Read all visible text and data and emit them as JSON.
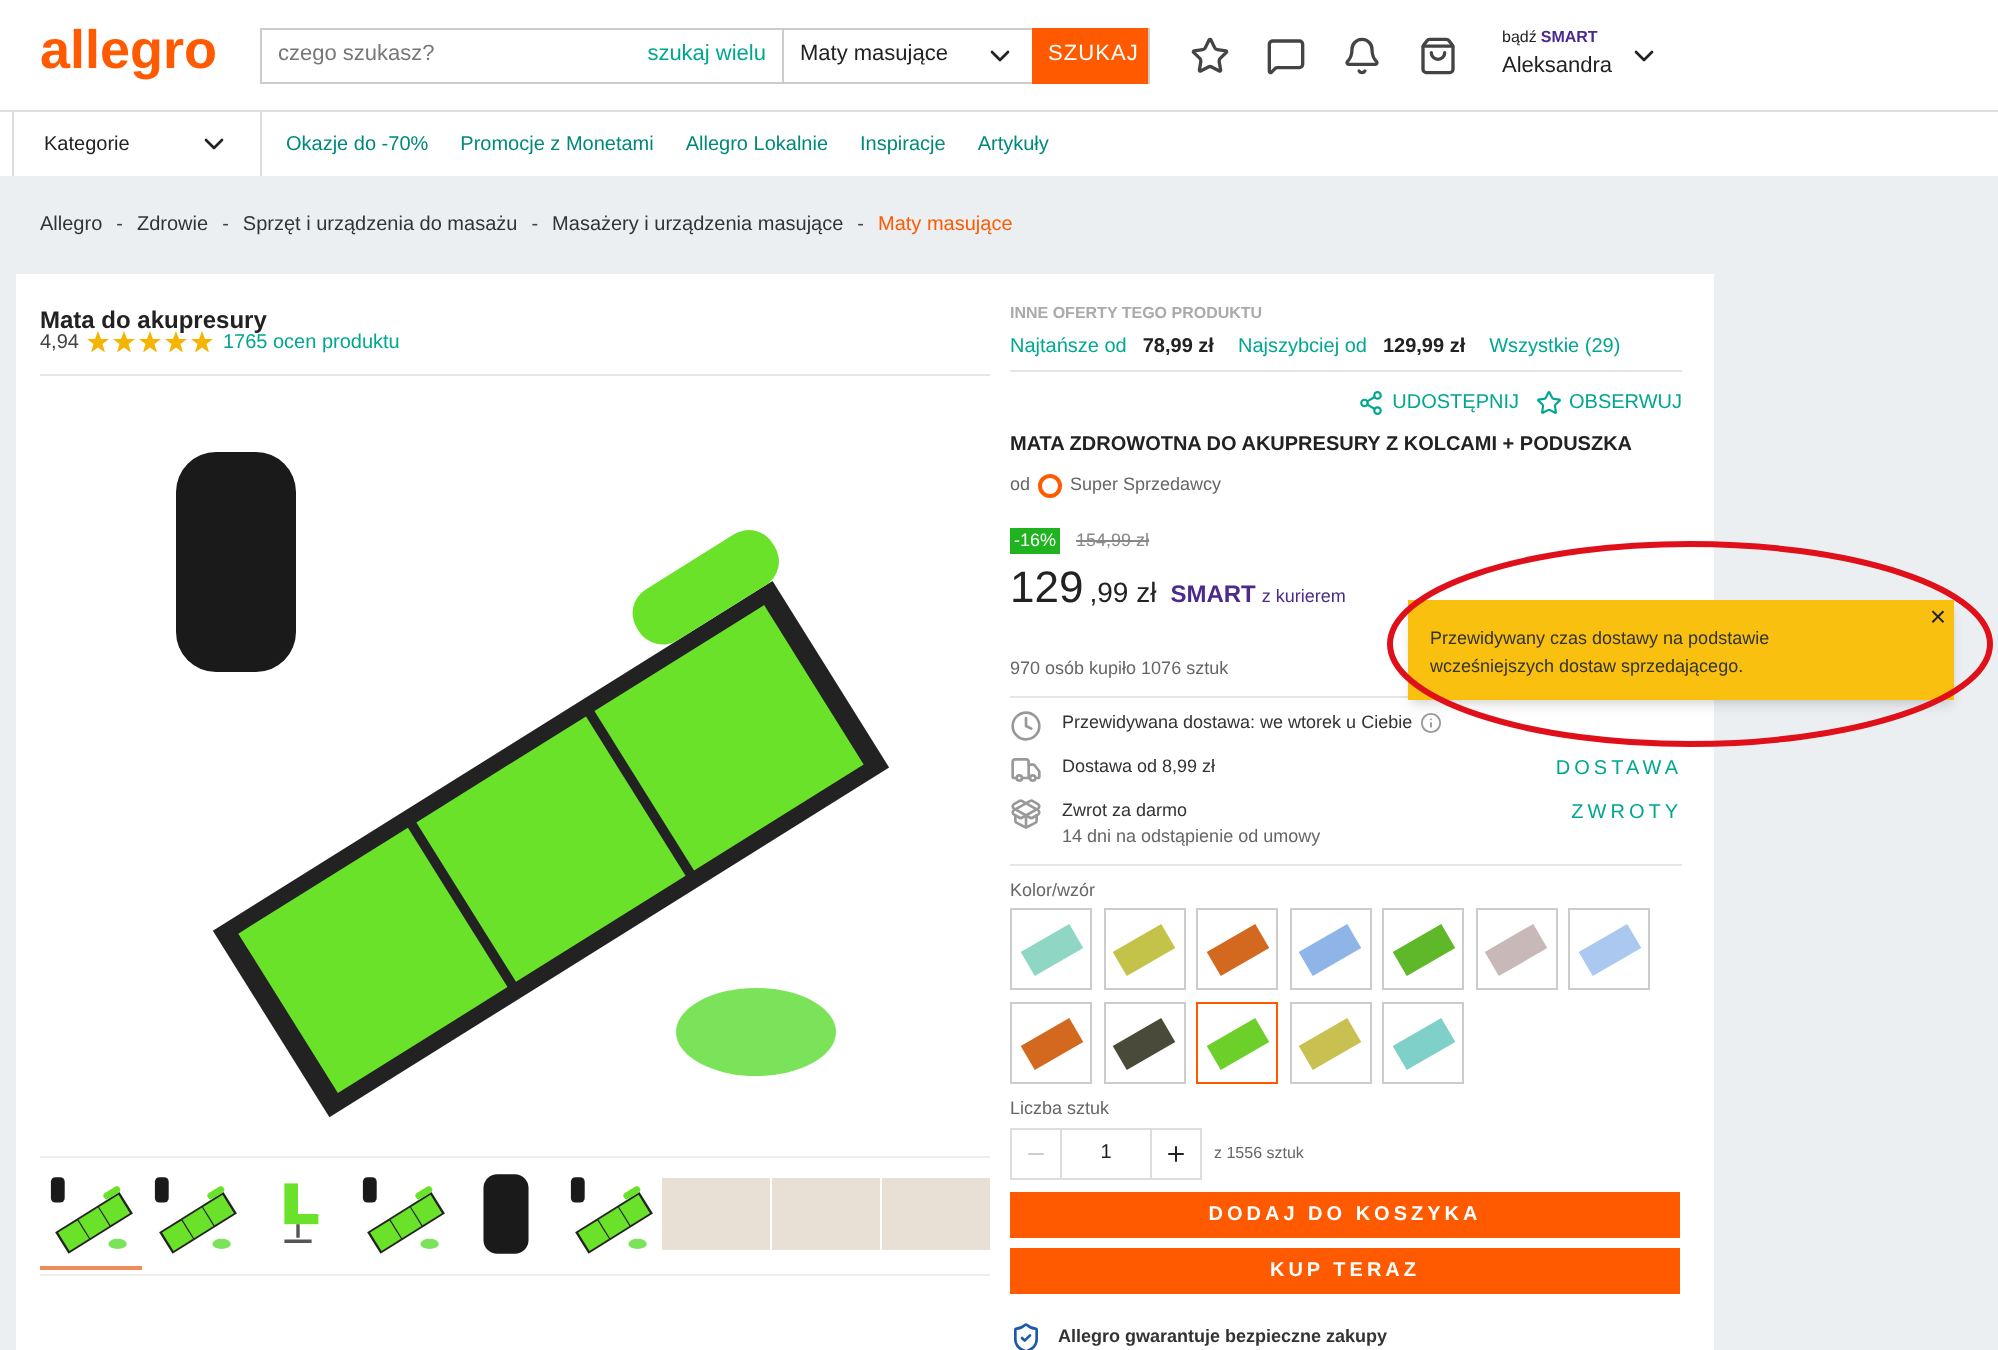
{
  "header": {
    "logo": "allegro",
    "search": {
      "placeholder": "czego szukasz?",
      "many_link": "szukaj wielu",
      "category": "Maty masujące",
      "button": "SZUKAJ"
    },
    "smart_prefix": "bądź",
    "smart": "SMART",
    "user": "Aleksandra"
  },
  "nav": {
    "categories": "Kategorie",
    "links": [
      "Okazje do -70%",
      "Promocje z Monetami",
      "Allegro Lokalnie",
      "Inspiracje",
      "Artykuły"
    ]
  },
  "breadcrumb": [
    {
      "label": "Allegro",
      "current": false
    },
    {
      "sep": "-",
      "label": "Zdrowie",
      "current": false
    },
    {
      "sep": "-",
      "label": "Sprzęt i urządzenia do masażu",
      "current": false
    },
    {
      "sep": "-",
      "label": "Masażery i urządzenia masujące",
      "current": false
    },
    {
      "sep": "-",
      "label": "Maty masujące",
      "current": true
    }
  ],
  "product": {
    "name": "Mata do akupresury",
    "rating": "4,94",
    "stars": 5,
    "reviews": "1765 ocen produktu",
    "thumbnails": [
      {
        "kind": "mat",
        "selected": true
      },
      {
        "kind": "mat",
        "selected": false
      },
      {
        "kind": "chair",
        "selected": false
      },
      {
        "kind": "mat",
        "selected": false
      },
      {
        "kind": "bag",
        "selected": false
      },
      {
        "kind": "mat",
        "selected": false
      },
      {
        "kind": "photo",
        "selected": false
      },
      {
        "kind": "photo",
        "selected": false
      },
      {
        "kind": "photo",
        "selected": false
      }
    ]
  },
  "offers": {
    "heading": "INNE OFERTY TEGO PRODUKTU",
    "items": [
      {
        "label": "Najtańsze od",
        "price": "78,99 zł"
      },
      {
        "label": "Najszybciej od",
        "price": "129,99 zł"
      }
    ],
    "all": "Wszystkie (29)"
  },
  "actions": [
    "UDOSTĘPNIJ",
    "OBSERWUJ"
  ],
  "offer": {
    "title": "MATA ZDROWOTNA DO AKUPRESURY Z KOLCAMI + PODUSZKA",
    "seller_prefix": "od",
    "seller": "Super Sprzedawcy",
    "discount": "-16%",
    "old_price": "154,99 zł",
    "price_main": "129",
    "price_cents": ",99 zł",
    "smart": "SMART",
    "courier": "z kurierem",
    "bought": "970 osób kupiło 1076 sztuk",
    "delivery": [
      {
        "kind": "clock",
        "text": "Przewidywana dostawa: we wtorek u Ciebie"
      },
      {
        "kind": "truck",
        "text": "Dostawa od 8,99 zł",
        "link": "DOSTAWA"
      },
      {
        "kind": "return",
        "text": "Zwrot za darmo",
        "sub": "14 dni na odstąpienie od umowy",
        "link": "ZWROTY"
      }
    ],
    "color_label": "Kolor/wzór",
    "swatches": [
      {
        "color": "#8fd6c4",
        "selected": false
      },
      {
        "color": "#c3c34a",
        "selected": false
      },
      {
        "color": "#d2691e",
        "selected": false
      },
      {
        "color": "#8fb4e8",
        "selected": false
      },
      {
        "color": "#5fb82a",
        "selected": false
      },
      {
        "color": "#c8b8b8",
        "selected": false
      },
      {
        "color": "#aac8f0",
        "selected": false
      },
      {
        "color": "#d2691e",
        "selected": false
      },
      {
        "color": "#4a4a3a",
        "selected": false
      },
      {
        "color": "#6ccf2a",
        "selected": true
      },
      {
        "color": "#c8c050",
        "selected": false
      },
      {
        "color": "#7fd0c8",
        "selected": false
      }
    ],
    "qty_label": "Liczba sztuk",
    "qty": "1",
    "stock": "z 1556 sztuk",
    "add_to_cart": "DODAJ DO KOSZYKA",
    "buy_now": "KUP TERAZ",
    "guarantee": "Allegro gwarantuje bezpieczne zakupy"
  },
  "tooltip": {
    "text": "Przewidywany czas dostawy na podstawie wcześniejszych dostaw sprzedającego.",
    "close": "×"
  }
}
